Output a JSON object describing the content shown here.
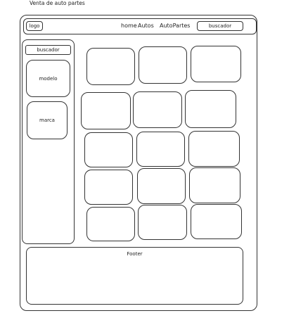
{
  "page": {
    "title": "Venta de auto partes"
  },
  "header": {
    "logo": "logo",
    "nav": [
      "home",
      "Autos",
      "AutoPartes"
    ],
    "search_label": "buscador"
  },
  "sidebar": {
    "search_label": "buscador",
    "filters": [
      "modelo",
      "marca"
    ]
  },
  "products": {
    "count": 15
  },
  "footer": {
    "label": "Footer"
  }
}
